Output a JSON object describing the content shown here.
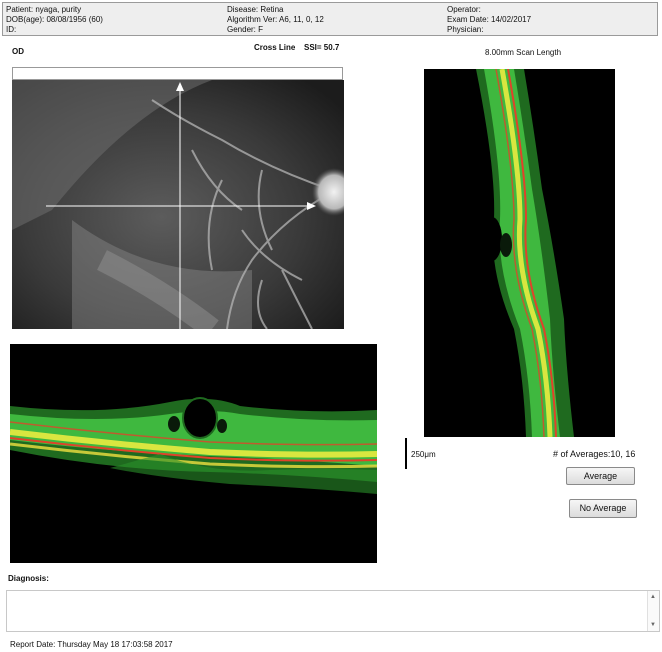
{
  "header": {
    "patient": "Patient: nyaga, purity",
    "dob": "DOB(age): 08/08/1956 (60)",
    "id": "ID:",
    "disease": "Disease: Retina",
    "algorithm": "Algorithm Ver: A6, 11, 0, 12",
    "gender": "Gender: F",
    "operator": "Operator:",
    "exam_date": "Exam Date: 14/02/2017",
    "physician": "Physician:"
  },
  "scan": {
    "eye": "OD",
    "mode": "Cross Line",
    "ssi": "SSI= 50.7",
    "scan_length": "8.00mm Scan Length",
    "scale_bar": "250μm",
    "averages": "# of Averages:10, 16"
  },
  "buttons": {
    "average": "Average",
    "no_average": "No Average"
  },
  "diagnosis": {
    "label": "Diagnosis:",
    "text": ""
  },
  "footer": {
    "report_date": "Report Date: Thursday May 18 17:03:58 2017"
  },
  "icons": {
    "scroll_up": "▲",
    "scroll_down": "▼"
  }
}
